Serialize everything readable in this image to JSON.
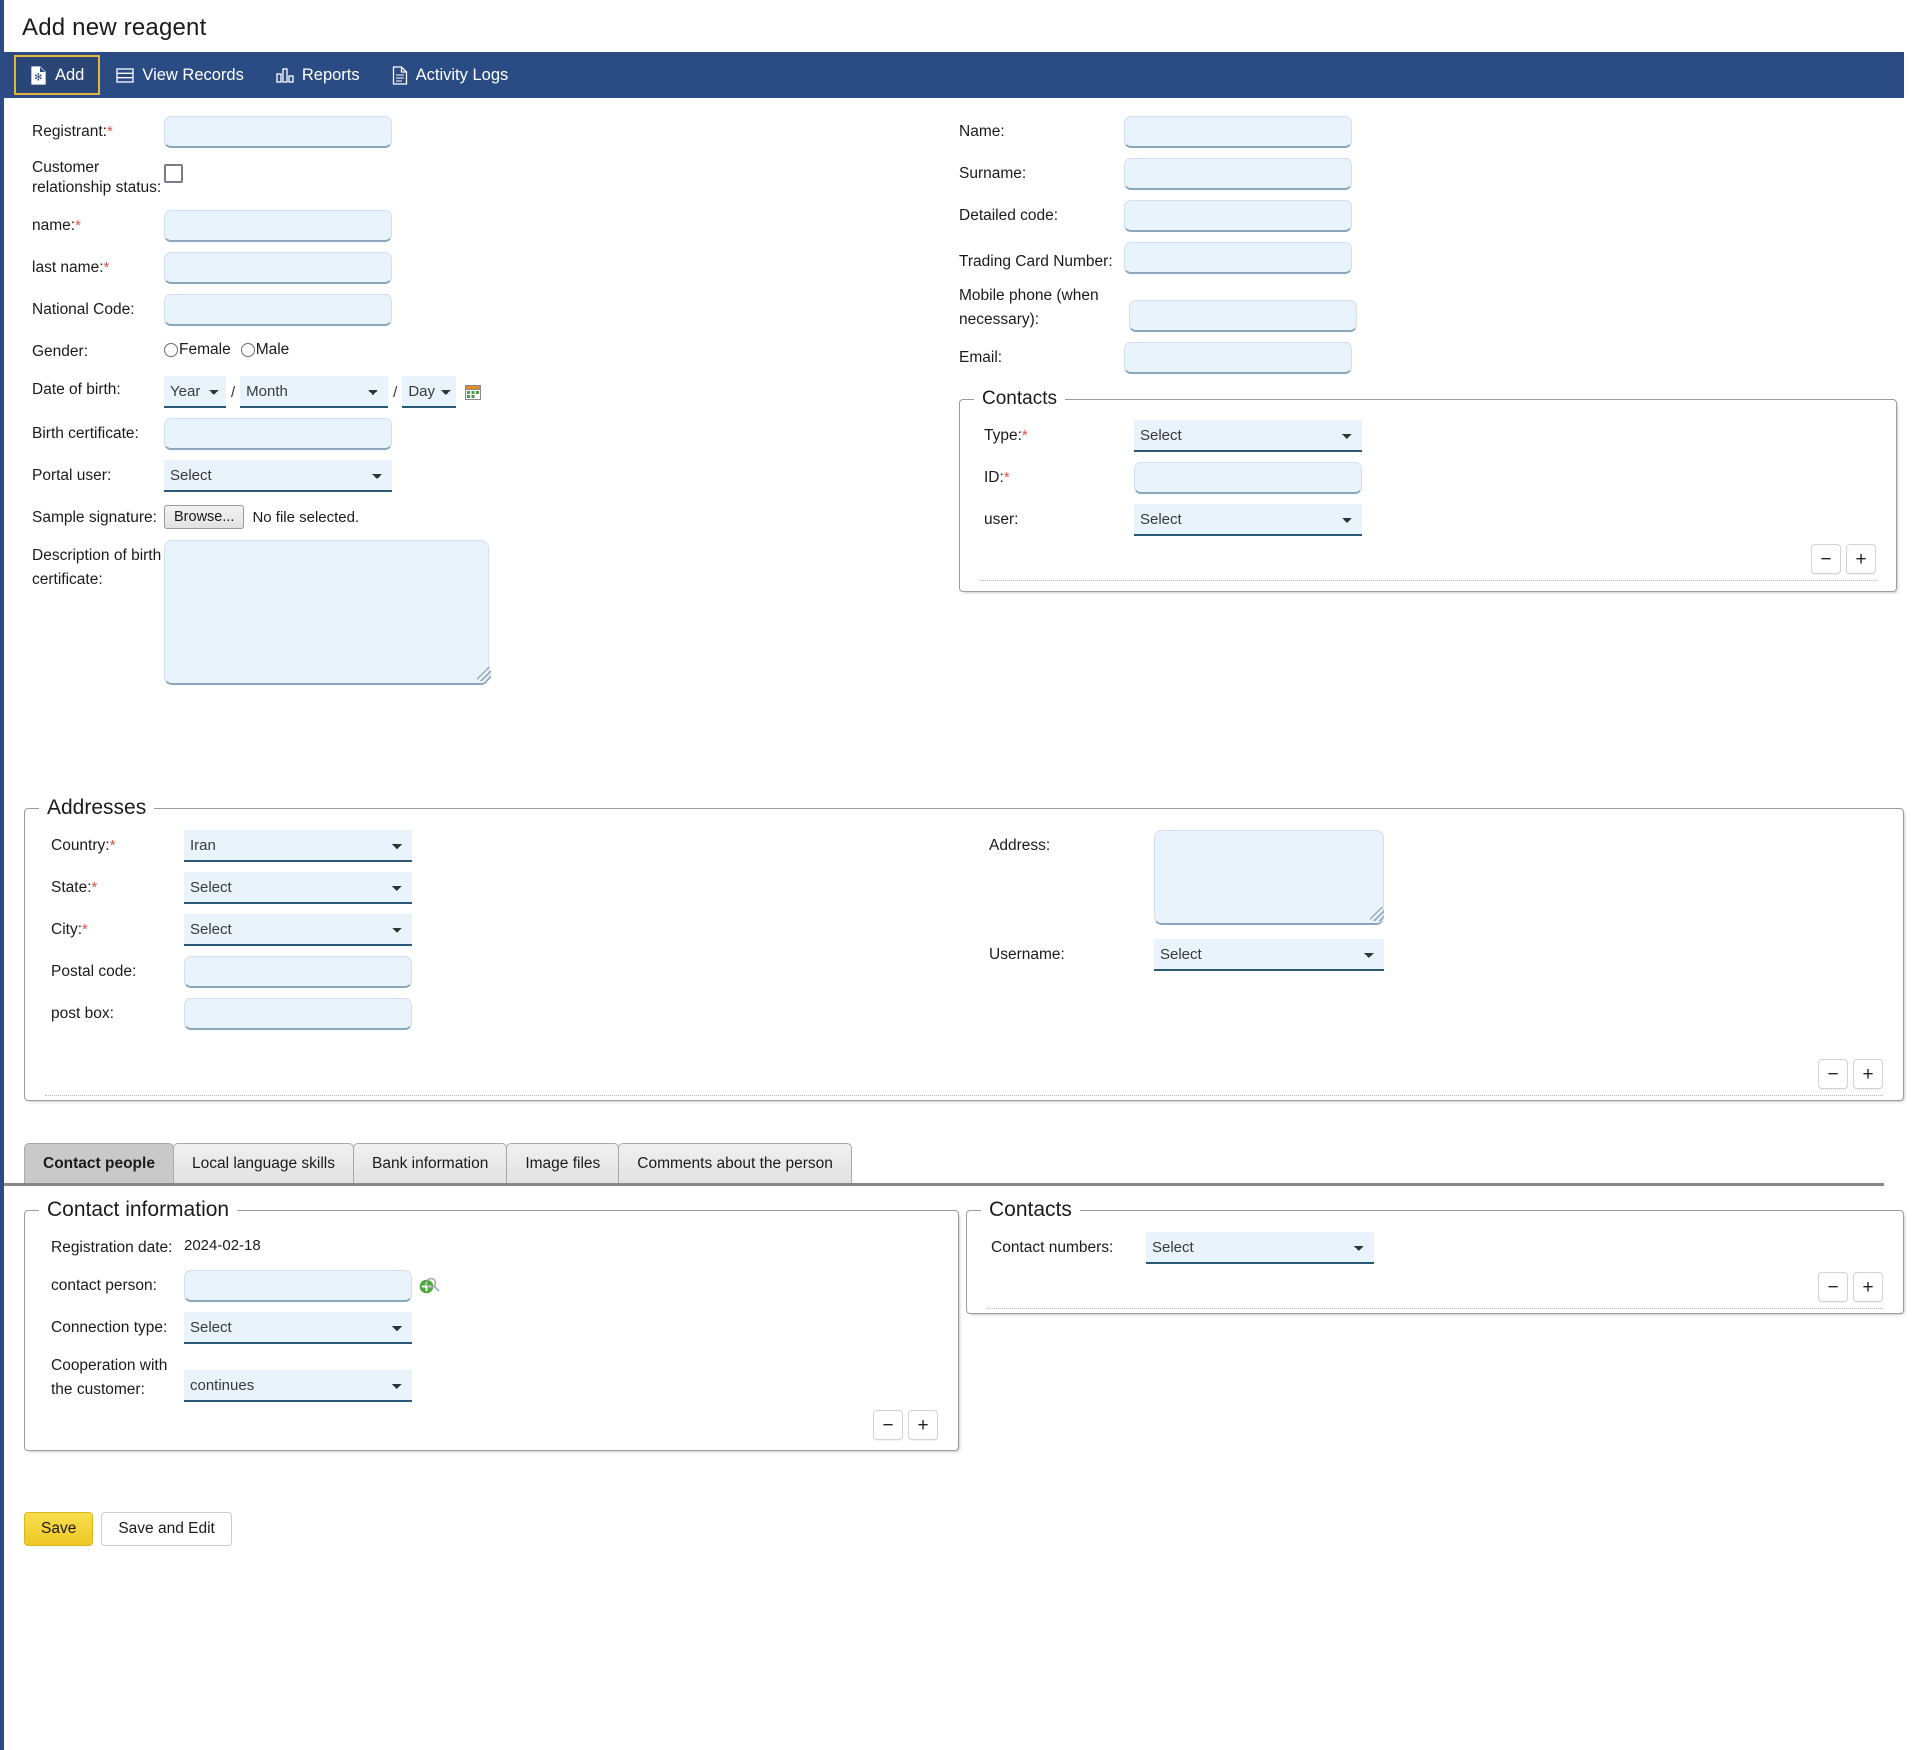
{
  "header": {
    "title": "Add new reagent"
  },
  "nav": {
    "items": [
      {
        "label": "Add",
        "icon": "file-add-icon",
        "active": true
      },
      {
        "label": "View Records",
        "icon": "list-rows-icon",
        "active": false
      },
      {
        "label": "Reports",
        "icon": "bar-chart-icon",
        "active": false
      },
      {
        "label": "Activity Logs",
        "icon": "document-icon",
        "active": false
      }
    ]
  },
  "left_form": {
    "registrant": {
      "label": "Registrant:",
      "required": true,
      "value": "",
      "placeholder": ""
    },
    "customer_relationship_status": {
      "label": "Customer relationship status:",
      "checked": false
    },
    "name": {
      "label": "name:",
      "required": true,
      "value": "",
      "placeholder": ""
    },
    "last_name": {
      "label": "last name:",
      "required": true,
      "value": "",
      "placeholder": ""
    },
    "national_code": {
      "label": "National Code:",
      "value": "",
      "placeholder": ""
    },
    "gender": {
      "label": "Gender:",
      "options": [
        "Female",
        "Male"
      ],
      "selected": ""
    },
    "date_of_birth": {
      "label": "Date of birth:",
      "year": "Year",
      "month": "Month",
      "day": "Day",
      "separator": "/",
      "calendar_icon": "calendar-icon"
    },
    "birth_certificate": {
      "label": "Birth certificate:",
      "value": "",
      "placeholder": ""
    },
    "portal_user": {
      "label": "Portal user:",
      "value": "Select"
    },
    "sample_signature": {
      "label": "Sample signature:",
      "button": "Browse...",
      "status": "No file selected."
    },
    "description_of_birth_certificate": {
      "label": "Description of birth certificate:",
      "value": "",
      "placeholder": ""
    }
  },
  "right_form": {
    "name": {
      "label": "Name:",
      "value": "",
      "placeholder": ""
    },
    "surname": {
      "label": "Surname:",
      "value": "",
      "placeholder": ""
    },
    "detailed_code": {
      "label": "Detailed code:",
      "value": "",
      "placeholder": ""
    },
    "trading_card_number": {
      "label": "Trading Card Number:",
      "value": "",
      "placeholder": ""
    },
    "mobile_phone": {
      "label": "Mobile phone (when necessary):",
      "value": "",
      "placeholder": ""
    },
    "email": {
      "label": "Email:",
      "value": "",
      "placeholder": ""
    }
  },
  "contacts_top": {
    "legend": "Contacts",
    "type": {
      "label": "Type:",
      "required": true,
      "value": "Select"
    },
    "id": {
      "label": "ID:",
      "required": true,
      "value": "",
      "placeholder": ""
    },
    "user": {
      "label": "user:",
      "value": "Select"
    },
    "remove_label": "−",
    "add_label": "+"
  },
  "addresses": {
    "legend": "Addresses",
    "country": {
      "label": "Country:",
      "required": true,
      "value": "Iran"
    },
    "state": {
      "label": "State:",
      "required": true,
      "value": "Select"
    },
    "city": {
      "label": "City:",
      "required": true,
      "value": "Select"
    },
    "postal_code": {
      "label": "Postal code:",
      "value": "",
      "placeholder": ""
    },
    "post_box": {
      "label": "post box:",
      "value": "",
      "placeholder": ""
    },
    "address": {
      "label": "Address:",
      "value": "",
      "placeholder": ""
    },
    "username": {
      "label": "Username:",
      "value": "Select"
    },
    "remove_label": "−",
    "add_label": "+"
  },
  "tabs": [
    {
      "label": "Contact people",
      "active": true
    },
    {
      "label": "Local language skills",
      "active": false
    },
    {
      "label": "Bank information",
      "active": false
    },
    {
      "label": "Image files",
      "active": false
    },
    {
      "label": "Comments about the person",
      "active": false
    }
  ],
  "contact_information": {
    "legend": "Contact information",
    "registration_date": {
      "label": "Registration date:",
      "value": "2024-02-18"
    },
    "contact_person": {
      "label": "contact person:",
      "value": "",
      "placeholder": "",
      "search_icon": "search-icon",
      "add_icon": "green-plus-icon"
    },
    "connection_type": {
      "label": "Connection type:",
      "value": "Select"
    },
    "cooperation_with_customer": {
      "label": "Cooperation with the customer:",
      "value": "continues"
    },
    "remove_label": "−",
    "add_label": "+"
  },
  "contacts_bottom": {
    "legend": "Contacts",
    "contact_numbers": {
      "label": "Contact numbers:",
      "value": "Select"
    },
    "remove_label": "−",
    "add_label": "+"
  },
  "footer": {
    "save": "Save",
    "save_and_edit": "Save and Edit"
  },
  "colors": {
    "navbar": "#2b4b84",
    "nav_active_border": "#e3b53b",
    "input_bg": "#e9f3fb",
    "required_star": "#e0544e",
    "save_button": "#efc825",
    "tab_active": "#c9c9c9"
  }
}
